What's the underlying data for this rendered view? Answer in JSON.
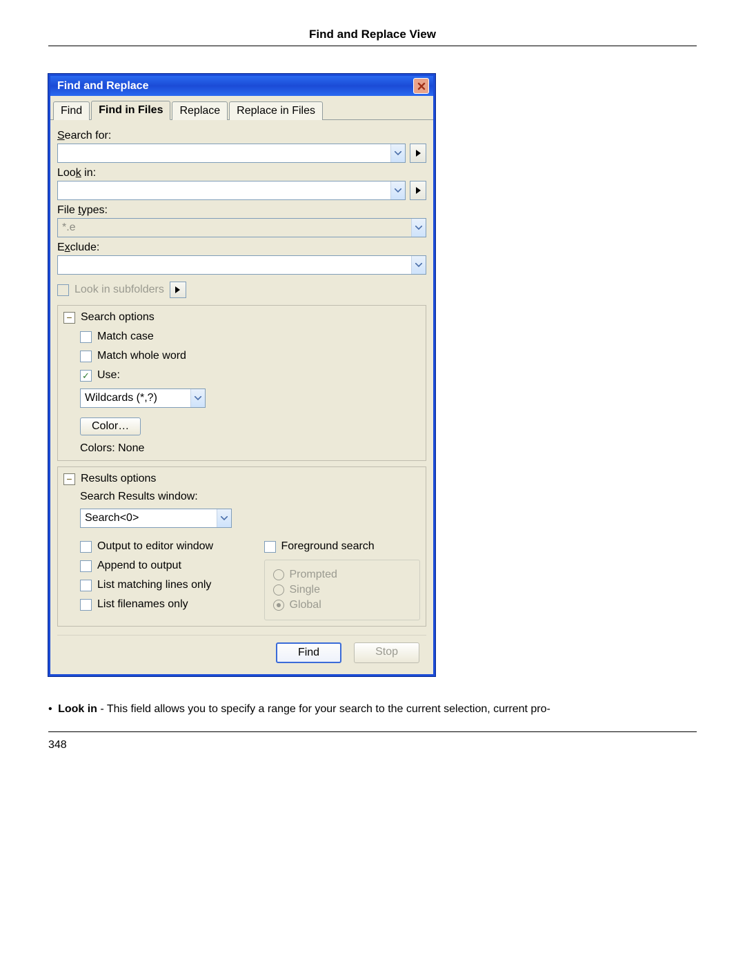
{
  "doc_header": "Find and Replace View",
  "titlebar": "Find and Replace",
  "tabs": [
    "Find",
    "Find in Files",
    "Replace",
    "Replace in Files"
  ],
  "labels": {
    "search_for": "Search for:",
    "look_in": "Look in:",
    "file_types": "File types:",
    "exclude": "Exclude:",
    "look_subfolders": "Look in subfolders"
  },
  "values": {
    "search_for": "",
    "look_in": "",
    "file_types": "*.e",
    "exclude": ""
  },
  "search_options": {
    "title": "Search options",
    "match_case": "Match case",
    "match_whole": "Match whole word",
    "use": "Use:",
    "use_select": "Wildcards (*,?)",
    "color_btn": "Color…",
    "colors_label": "Colors: None"
  },
  "results_options": {
    "title": "Results options",
    "window_label": "Search Results window:",
    "window_select": "Search<0>",
    "output_editor": "Output to editor window",
    "append": "Append to output",
    "matching_lines": "List matching lines only",
    "filenames_only": "List filenames only",
    "foreground": "Foreground search",
    "radios": [
      "Prompted",
      "Single",
      "Global"
    ]
  },
  "footer": {
    "find": "Find",
    "stop": "Stop"
  },
  "note_bold": "Look in",
  "note_rest": " - This field allows you to specify a range for your search to the current selection, current pro-",
  "page_no": "348"
}
